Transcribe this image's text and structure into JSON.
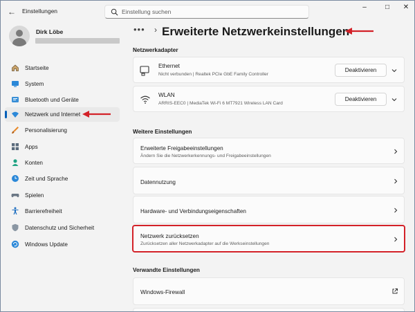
{
  "titlebar": {
    "app_title": "Einstellungen",
    "search_placeholder": "Einstellung suchen",
    "minimize": "–",
    "maximize": "□",
    "close": "✕",
    "back": "←"
  },
  "user": {
    "name": "Dirk Löbe"
  },
  "sidebar": {
    "items": [
      {
        "label": "Startseite",
        "icon": "home-icon"
      },
      {
        "label": "System",
        "icon": "system-icon"
      },
      {
        "label": "Bluetooth und Geräte",
        "icon": "bluetooth-icon"
      },
      {
        "label": "Netzwerk und Internet",
        "icon": "wifi-icon",
        "selected": true
      },
      {
        "label": "Personalisierung",
        "icon": "brush-icon"
      },
      {
        "label": "Apps",
        "icon": "apps-icon"
      },
      {
        "label": "Konten",
        "icon": "account-icon"
      },
      {
        "label": "Zeit und Sprache",
        "icon": "globe-clock-icon"
      },
      {
        "label": "Spielen",
        "icon": "gamepad-icon"
      },
      {
        "label": "Barrierefreiheit",
        "icon": "accessibility-icon"
      },
      {
        "label": "Datenschutz und Sicherheit",
        "icon": "shield-icon"
      },
      {
        "label": "Windows Update",
        "icon": "update-icon"
      }
    ]
  },
  "main": {
    "breadcrumb_dots": "•••",
    "breadcrumb_sep": "›",
    "page_title": "Erweiterte Netzwerkeinstellungen",
    "adapters_header": "Netzwerkadapter",
    "adapters": [
      {
        "name": "Ethernet",
        "detail": "Nicht verbunden | Realtek PCIe GbE Family Controller",
        "button": "Deaktivieren",
        "icon": "ethernet-icon"
      },
      {
        "name": "WLAN",
        "detail": "ARRIS-EEC0 | MediaTek Wi-Fi 6 MT7921 Wireless LAN Card",
        "button": "Deaktivieren",
        "icon": "wifi-icon"
      }
    ],
    "more_header": "Weitere Einstellungen",
    "more": [
      {
        "title": "Erweiterte Freigabeeinstellungen",
        "sub": "Ändern Sie die Netzwerkerkennungs- und Freigabeeinstellungen"
      },
      {
        "title": "Datennutzung",
        "sub": ""
      },
      {
        "title": "Hardware- und Verbindungseigenschaften",
        "sub": ""
      },
      {
        "title": "Netzwerk zurücksetzen",
        "sub": "Zurücksetzen aller Netzwerkadapter auf die Werkseinstellungen"
      }
    ],
    "related_header": "Verwandte Einstellungen",
    "related": [
      {
        "title": "Windows-Firewall"
      }
    ]
  },
  "colors": {
    "accent": "#005fb8",
    "annotation_red": "#d32128"
  }
}
